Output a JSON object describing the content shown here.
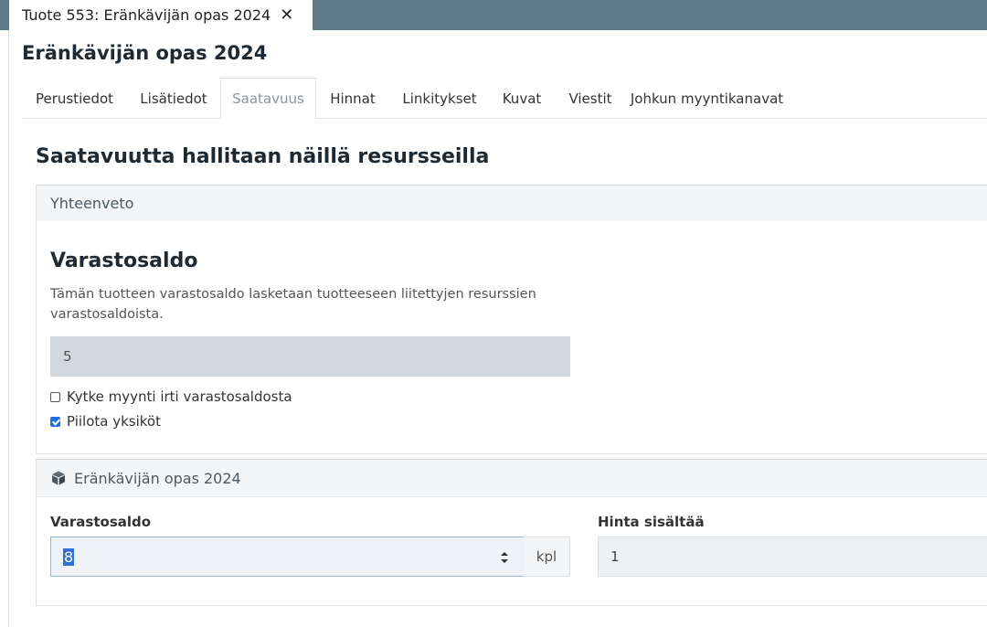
{
  "window": {
    "tab_title": "Tuote 553: Eränkävijän opas 2024",
    "close_glyph": "✕"
  },
  "page": {
    "title": "Eränkävijän opas 2024"
  },
  "tabs": [
    {
      "label": "Perustiedot",
      "active": false
    },
    {
      "label": "Lisätiedot",
      "active": false
    },
    {
      "label": "Saatavuus",
      "active": true
    },
    {
      "label": "Hinnat",
      "active": false
    },
    {
      "label": "Linkitykset",
      "active": false
    },
    {
      "label": "Kuvat",
      "active": false
    },
    {
      "label": "Viestit",
      "active": false
    },
    {
      "label": "Johkun myyntikanavat",
      "active": false
    }
  ],
  "section": {
    "title": "Saatavuutta hallitaan näillä resursseilla"
  },
  "summary": {
    "header": "Yhteenveto",
    "stock_title": "Varastosaldo",
    "description": "Tämän tuotteen varastosaldo lasketaan tuotteeseen liitettyjen resurssien varastosaldoista.",
    "stock_value": "5",
    "options": [
      {
        "label": "Kytke myynti irti varastosaldosta",
        "checked": false
      },
      {
        "label": "Piilota yksiköt",
        "checked": true
      }
    ]
  },
  "resource": {
    "icon": "cube-icon",
    "header": "Eränkävijän opas 2024",
    "stock_label": "Varastosaldo",
    "stock_value": "8",
    "unit": "kpl",
    "price_label": "Hinta sisältää",
    "price_value": "1"
  },
  "colors": {
    "topbar": "#5f7b8a",
    "accent": "#1a73e8"
  }
}
